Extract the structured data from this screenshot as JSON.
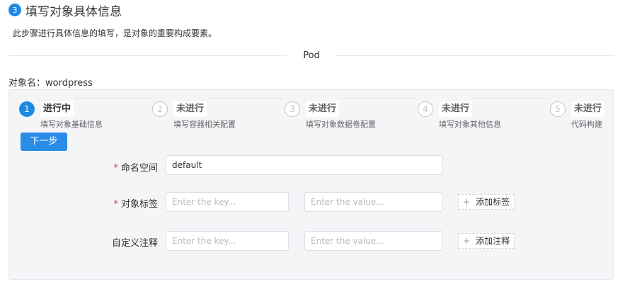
{
  "header": {
    "step_number": "3",
    "title": "填写对象具体信息",
    "description": "此步骤进行具体信息的填写，是对象的重要构成要素。"
  },
  "divider": {
    "label": "Pod"
  },
  "object": {
    "label": "对象名：wordpress"
  },
  "steps": [
    {
      "number": "1",
      "status": "进行中",
      "desc": "填写对象基础信息"
    },
    {
      "number": "2",
      "status": "未进行",
      "desc": "填写容器相关配置"
    },
    {
      "number": "3",
      "status": "未进行",
      "desc": "填写对象数据卷配置"
    },
    {
      "number": "4",
      "status": "未进行",
      "desc": "填写对象其他信息"
    },
    {
      "number": "5",
      "status": "未进行",
      "desc": "代码构建"
    }
  ],
  "next_button": "下一步",
  "form": {
    "namespace": {
      "label": "命名空间",
      "value": "default"
    },
    "labels": {
      "label": "对象标签",
      "key_placeholder": "Enter the key...",
      "value_placeholder": "Enter the value...",
      "add_label": "添加标签"
    },
    "annotations": {
      "label": "自定义注释",
      "key_placeholder": "Enter the key...",
      "value_placeholder": "Enter the value...",
      "add_label": "添加注释"
    }
  },
  "colors": {
    "accent": "#1e88e5",
    "required": "#e53935"
  }
}
